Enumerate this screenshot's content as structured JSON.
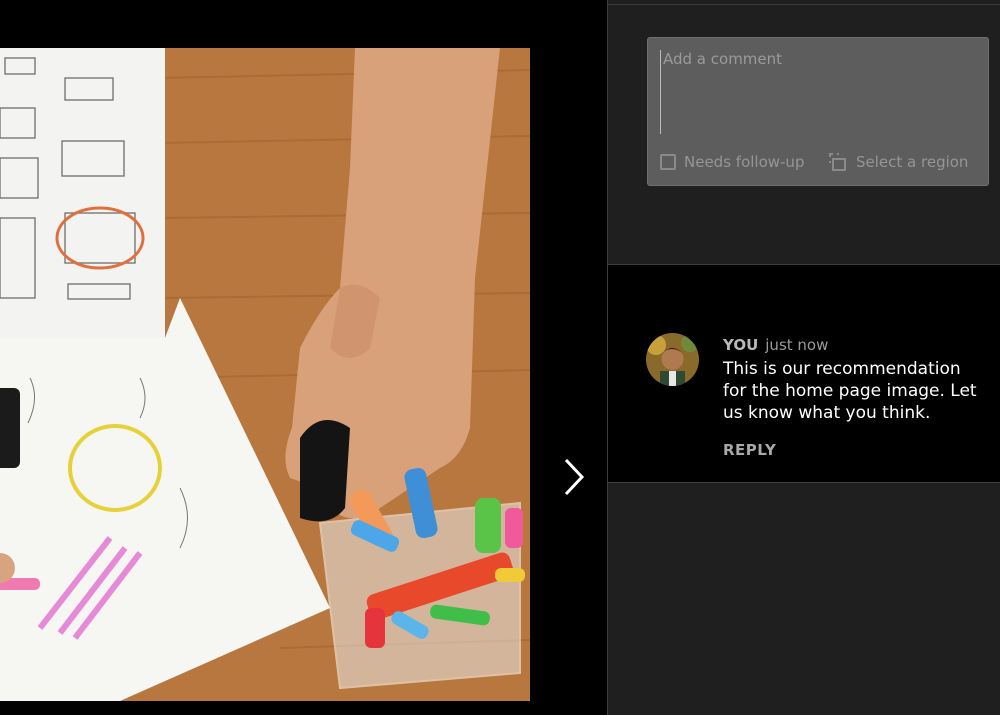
{
  "composer": {
    "placeholder": "Add a comment",
    "follow_up_label": "Needs follow-up",
    "select_region_label": "Select a region"
  },
  "comment": {
    "author": "YOU",
    "time": "just now",
    "text": "This is our recommendation for the home page image. Let us know what you think.",
    "reply_label": "REPLY"
  },
  "icons": {
    "next": "chevron-right-icon",
    "checkbox": "checkbox-icon",
    "region": "select-region-icon",
    "avatar": "user-avatar"
  },
  "colors": {
    "panel_bg": "#1f1f1f",
    "comment_bg": "#000000",
    "composer_bg": "#5d5d5d"
  }
}
